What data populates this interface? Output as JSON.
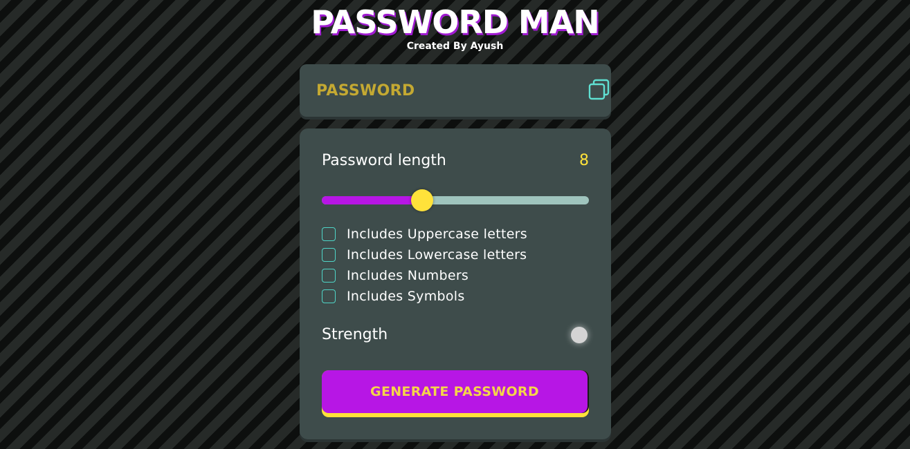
{
  "header": {
    "title": "PASSWORD MAN",
    "subtitle": "Created By Ayush"
  },
  "display": {
    "placeholder": "PASSWORD",
    "copy_icon": "copy-icon"
  },
  "length": {
    "label": "Password length",
    "value": "8",
    "slider_fraction": 0.375
  },
  "options": [
    {
      "label": "Includes Uppercase letters",
      "checked": false
    },
    {
      "label": "Includes Lowercase letters",
      "checked": false
    },
    {
      "label": "Includes Numbers",
      "checked": false
    },
    {
      "label": "Includes Symbols",
      "checked": false
    }
  ],
  "strength": {
    "label": "Strength",
    "indicator_color": "#d4d4d4"
  },
  "generate": {
    "label": "GENERATE PASSWORD"
  },
  "colors": {
    "accent_purple": "#b716e5",
    "accent_yellow": "#ffe23a",
    "accent_teal": "#4fd6c8",
    "panel": "#3e4c4b"
  }
}
